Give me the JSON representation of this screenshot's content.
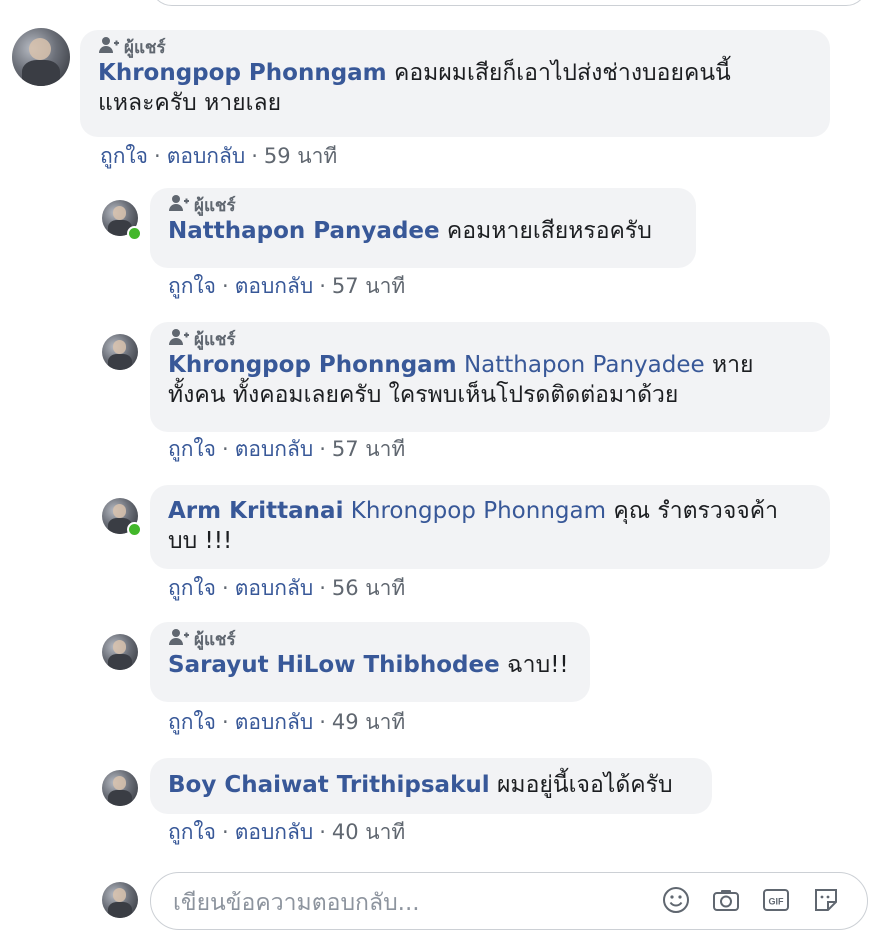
{
  "shared_label": "ผู้แชร์",
  "actions": {
    "like": "ถูกใจ",
    "reply": "ตอบกลับ",
    "sep": "·"
  },
  "comments": [
    {
      "author": "Khrongpop Phonngam",
      "text": "คอมผมเสียก็เอาไปส่งช่างบอยคนนี้",
      "text2": "แหละครับ หายเลย",
      "time": "59 นาที"
    },
    {
      "author": "Natthapon Panyadee",
      "text": "คอมหายเสียหรอครับ",
      "time": "57 นาที"
    },
    {
      "author": "Khrongpop Phonngam",
      "mention": "Natthapon Panyadee",
      "text": "หาย",
      "text2": "ทั้งคน ทั้งคอมเลยครับ ใครพบเห็นโปรดติดต่อมาด้วย",
      "time": "57 นาที"
    },
    {
      "author": "Arm Krittanai",
      "mention": "Khrongpop Phonngam",
      "text": "คุณ รำตรวจจค้า",
      "text2": "บบ !!!",
      "time": "56 นาที"
    },
    {
      "author": "Sarayut HiLow Thibhodee",
      "text": "ฉาบ!!",
      "time": "49 นาที"
    },
    {
      "author": "Boy Chaiwat Trithipsakul",
      "text": "ผมอยู่นี้เจอได้ครับ",
      "time": "40 นาที"
    }
  ],
  "reply_input": {
    "placeholder": "เขียนข้อความตอบกลับ..."
  },
  "reply_icons": [
    "emoji-icon",
    "camera-icon",
    "gif-icon",
    "sticker-icon"
  ],
  "colors": {
    "link": "#385898",
    "bubble": "#f2f3f5",
    "meta": "#606770",
    "online": "#42b72a"
  }
}
